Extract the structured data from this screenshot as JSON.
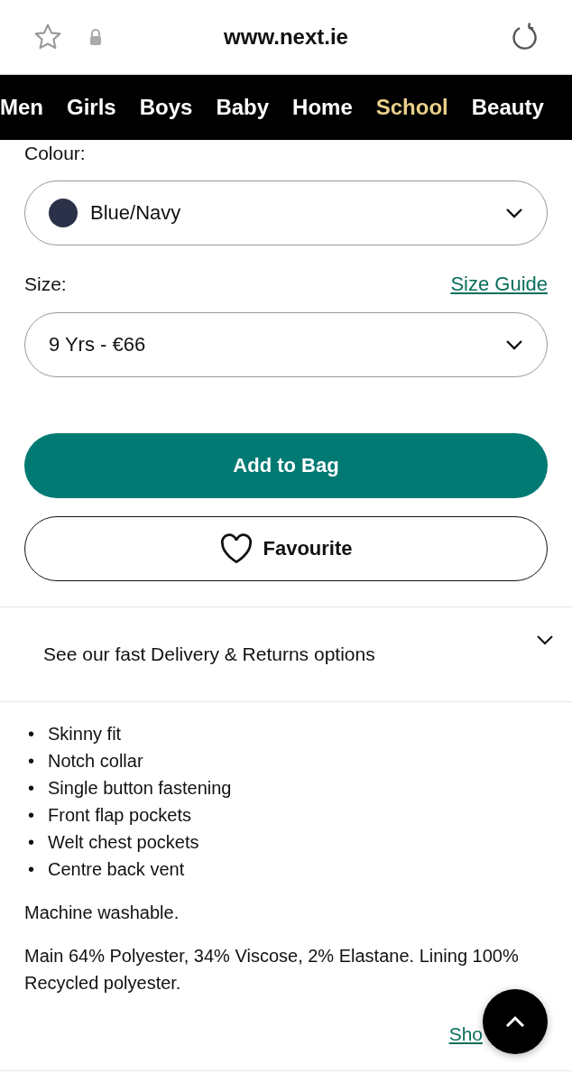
{
  "browser": {
    "url": "www.next.ie"
  },
  "nav": [
    {
      "label": "Men",
      "selected": false
    },
    {
      "label": "Girls",
      "selected": false
    },
    {
      "label": "Boys",
      "selected": false
    },
    {
      "label": "Baby",
      "selected": false
    },
    {
      "label": "Home",
      "selected": false
    },
    {
      "label": "School",
      "selected": true
    },
    {
      "label": "Beauty",
      "selected": false
    }
  ],
  "colour": {
    "label": "Colour:",
    "value": "Blue/Navy",
    "color": "#2b3148"
  },
  "size": {
    "label": "Size:",
    "guide": "Size Guide",
    "value": "9 Yrs - €66"
  },
  "add_button": "Add to Bag",
  "favourite_button": "Favourite",
  "delivery": {
    "label": "See our fast Delivery & Returns options",
    "expanded": false
  },
  "features": [
    {
      "marker": "•",
      "text": "Skinny fit"
    },
    {
      "marker": "•",
      "text": "Notch collar"
    },
    {
      "marker": "•",
      "text": "Single button fastening"
    },
    {
      "marker": "•",
      "text": "Front flap pockets"
    },
    {
      "marker": "•",
      "text": "Welt chest pockets"
    },
    {
      "marker": "•",
      "text": "Centre back vent"
    }
  ],
  "care": "Machine washable.",
  "composition": "Main 64% Polyester, 34% Viscose, 2% Elastane. Lining 100% Recycled polyester.",
  "more_link": "Sho"
}
